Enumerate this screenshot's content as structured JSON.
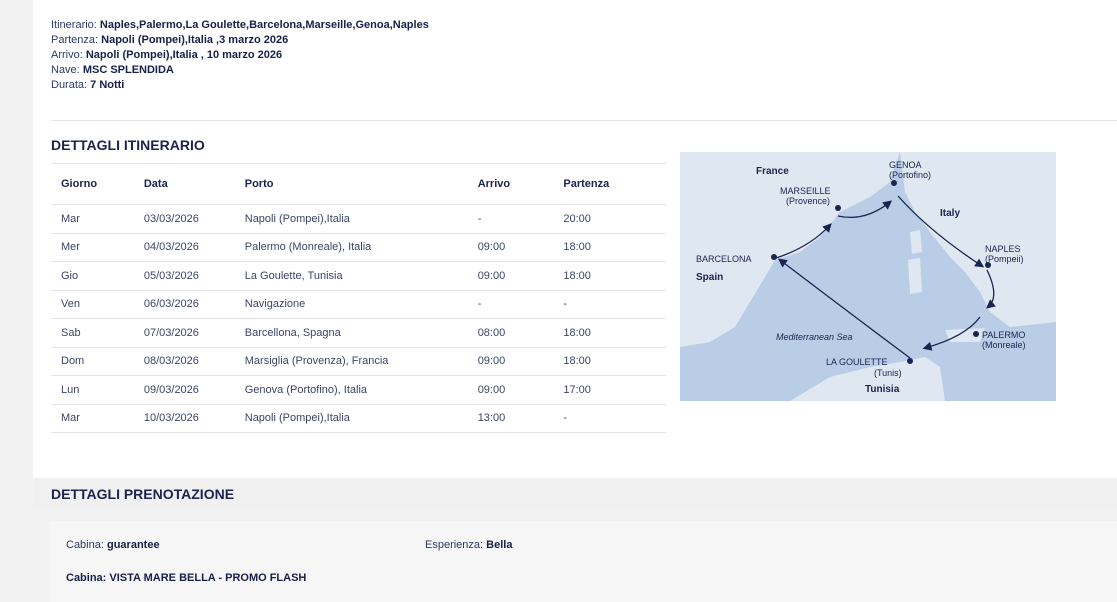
{
  "summary": {
    "itinerary_label": "Itinerario:",
    "itinerary_value": "Naples,Palermo,La Goulette,Barcelona,Marseille,Genoa,Naples",
    "departure_label": "Partenza:",
    "departure_value": "Napoli (Pompei),Italia ,3 marzo 2026",
    "arrival_label": "Arrivo:",
    "arrival_value": "Napoli (Pompei),Italia , 10 marzo 2026",
    "ship_label": "Nave:",
    "ship_value": "MSC SPLENDIDA",
    "duration_label": "Durata:",
    "duration_value": "7 Notti"
  },
  "itinerary": {
    "title": "DETTAGLI ITINERARIO",
    "columns": [
      "Giorno",
      "Data",
      "Porto",
      "Arrivo",
      "Partenza"
    ],
    "rows": [
      [
        "Mar",
        "03/03/2026",
        "Napoli (Pompei),Italia",
        "-",
        "20:00"
      ],
      [
        "Mer",
        "04/03/2026",
        "Palermo (Monreale), Italia",
        "09:00",
        "18:00"
      ],
      [
        "Gio",
        "05/03/2026",
        "La Goulette, Tunisia",
        "09:00",
        "18:00"
      ],
      [
        "Ven",
        "06/03/2026",
        "Navigazione",
        "-",
        "-"
      ],
      [
        "Sab",
        "07/03/2026",
        "Barcellona, Spagna",
        "08:00",
        "18:00"
      ],
      [
        "Dom",
        "08/03/2026",
        "Marsiglia (Provenza), Francia",
        "09:00",
        "18:00"
      ],
      [
        "Lun",
        "09/03/2026",
        "Genova (Portofino), Italia",
        "09:00",
        "17:00"
      ],
      [
        "Mar",
        "10/03/2026",
        "Napoli (Pompei),Italia",
        "13:00",
        "-"
      ]
    ]
  },
  "map": {
    "country_france": "France",
    "country_italy": "Italy",
    "country_spain": "Spain",
    "country_tunisia": "Tunisia",
    "sea": "Mediterranean Sea",
    "genoa": "GENOA",
    "genoa_sub": "(Portofino)",
    "marseille": "MARSEILLE",
    "marseille_sub": "(Provence)",
    "barcelona": "BARCELONA",
    "naples": "NAPLES",
    "naples_sub": "(Pompeii)",
    "palermo": "PALERMO",
    "palermo_sub": "(Monreale)",
    "lagoulette": "LA GOULETTE",
    "lagoulette_sub": "(Tunis)",
    "colors": {
      "sea": "#b9cde6",
      "land": "#dfe7f1",
      "route": "#1b2350"
    }
  },
  "booking": {
    "title": "DETTAGLI PRENOTAZIONE",
    "cabin_label": "Cabina:",
    "cabin_value": "guarantee",
    "experience_label": "Esperienza:",
    "experience_value": "Bella",
    "cabin2_label": "Cabina:",
    "cabin2_value": "VISTA MARE BELLA - PROMO FLASH"
  }
}
